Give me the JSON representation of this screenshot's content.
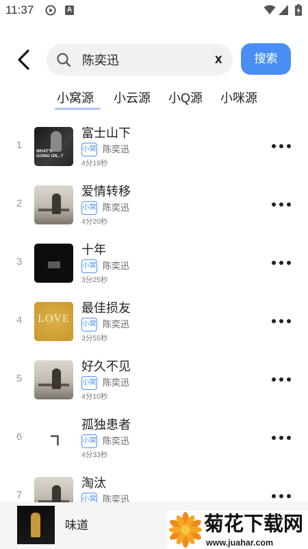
{
  "status_bar": {
    "time": "11:37",
    "notification_letter": "A",
    "icons": [
      "play-circle-icon",
      "a-app-icon",
      "wifi-icon",
      "signal-icon",
      "battery-charging-icon"
    ]
  },
  "header": {
    "back_icon": "chevron-left-icon",
    "search": {
      "icon": "search-icon",
      "value": "陈奕迅",
      "clear_label": "x"
    },
    "search_button": "搜索"
  },
  "tabs": [
    {
      "label": "小窝源",
      "selected": true
    },
    {
      "label": "小云源",
      "selected": false
    },
    {
      "label": "小Q源",
      "selected": false
    },
    {
      "label": "小咪源",
      "selected": false
    }
  ],
  "songs": [
    {
      "index": "1",
      "title": "富士山下",
      "badge": "小窝",
      "artist": "陈奕迅",
      "duration": "4分19秒",
      "cover_text": "WHAT'S GOING ON...?"
    },
    {
      "index": "2",
      "title": "爱情转移",
      "badge": "小窝",
      "artist": "陈奕迅",
      "duration": "4分20秒"
    },
    {
      "index": "3",
      "title": "十年",
      "badge": "小窝",
      "artist": "陈奕迅",
      "duration": "3分25秒"
    },
    {
      "index": "4",
      "title": "最佳损友",
      "badge": "小窝",
      "artist": "陈奕迅",
      "duration": "3分55秒",
      "cover_text": "LOVE"
    },
    {
      "index": "5",
      "title": "好久不见",
      "badge": "小窝",
      "artist": "陈奕迅",
      "duration": "4分10秒"
    },
    {
      "index": "6",
      "title": "孤独患者",
      "badge": "小窝",
      "artist": "陈奕迅",
      "duration": "4分33秒"
    },
    {
      "index": "7",
      "title": "淘汰",
      "badge": "小窝",
      "artist": "陈奕迅"
    }
  ],
  "more_icon": "more-horizontal-icon",
  "player": {
    "title": "味道"
  },
  "watermark": {
    "name": "菊花下载网",
    "url": "www.juahar.com"
  },
  "colors": {
    "accent": "#4b8ef3",
    "tab_underline": "#a9c6f2"
  }
}
